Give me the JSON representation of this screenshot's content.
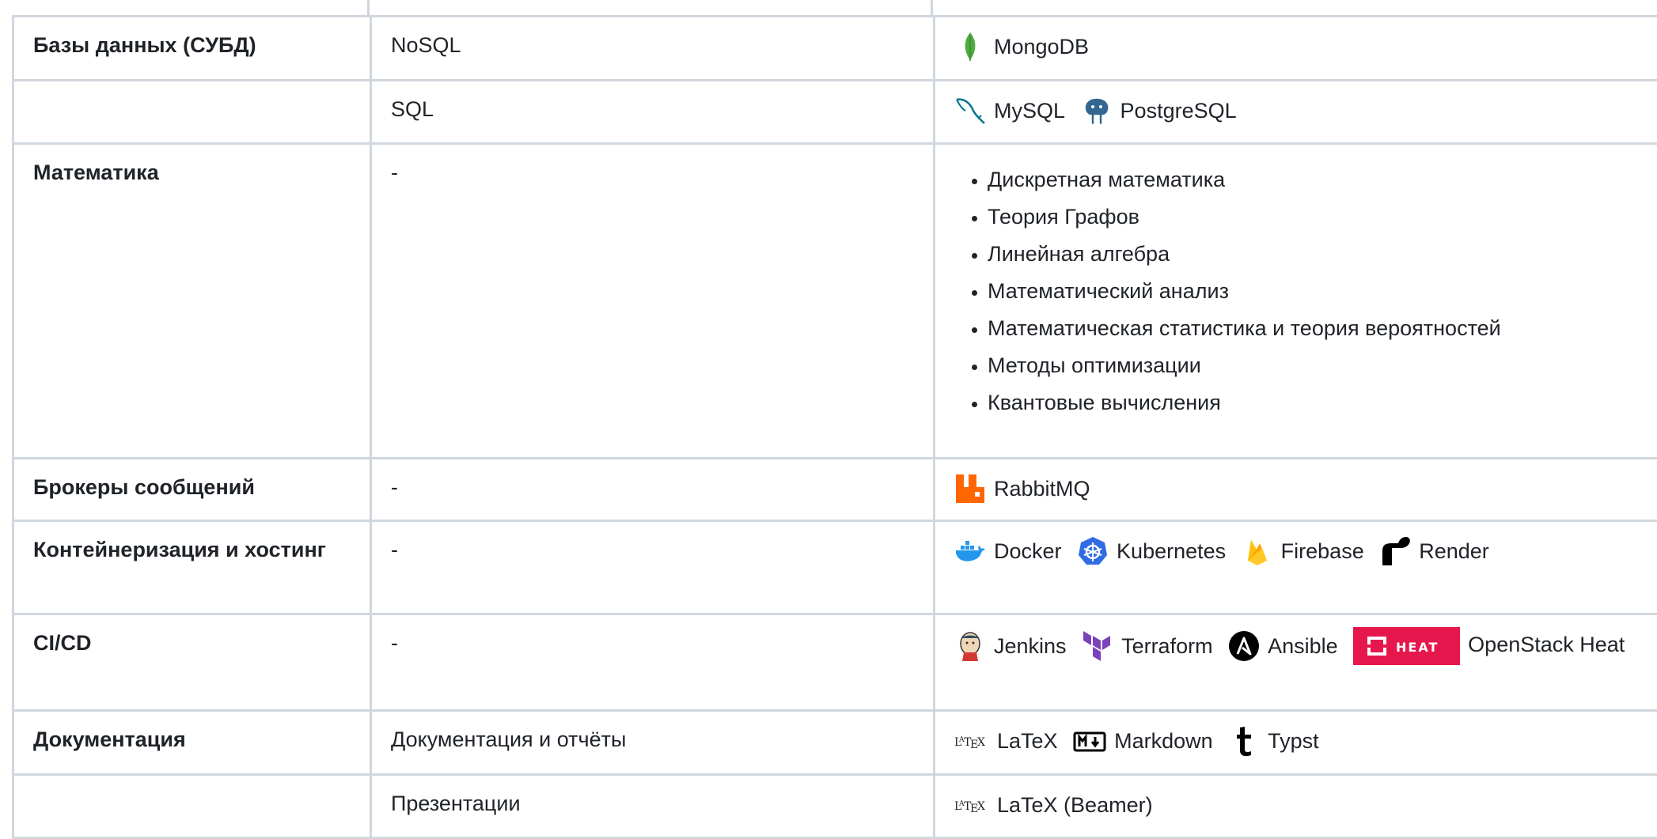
{
  "table": {
    "rows": [
      {
        "category": "Базы данных (СУБД)",
        "sub": "NoSQL",
        "tech": [
          {
            "icon": "mongodb-icon",
            "label": "MongoDB"
          }
        ]
      },
      {
        "category": "",
        "sub": "SQL",
        "tech": [
          {
            "icon": "mysql-icon",
            "label": "MySQL"
          },
          {
            "icon": "postgresql-icon",
            "label": "PostgreSQL"
          }
        ]
      },
      {
        "category": "Математика",
        "sub": "-",
        "list": [
          "Дискретная математика",
          "Теория Графов",
          "Линейная алгебра",
          "Математический анализ",
          "Математическая статистика и теория вероятностей",
          "Методы оптимизации",
          "Квантовые вычисления"
        ]
      },
      {
        "category": "Брокеры сообщений",
        "sub": "-",
        "tech": [
          {
            "icon": "rabbitmq-icon",
            "label": "RabbitMQ"
          }
        ]
      },
      {
        "category": "Контейнеризация и хостинг",
        "sub": "-",
        "tech": [
          {
            "icon": "docker-icon",
            "label": "Docker"
          },
          {
            "icon": "kubernetes-icon",
            "label": "Kubernetes"
          },
          {
            "icon": "firebase-icon",
            "label": "Firebase"
          },
          {
            "icon": "render-icon",
            "label": "Render"
          }
        ]
      },
      {
        "category": "CI/CD",
        "sub": "-",
        "tech": [
          {
            "icon": "jenkins-icon",
            "label": "Jenkins"
          },
          {
            "icon": "terraform-icon",
            "label": "Terraform"
          },
          {
            "icon": "ansible-icon",
            "label": "Ansible"
          },
          {
            "icon": "openstack-heat-badge",
            "badge_text": "HEAT",
            "label": "OpenStack Heat"
          }
        ]
      },
      {
        "category": "Документация",
        "sub": "Документация и отчёты",
        "tech": [
          {
            "icon": "latex-icon",
            "label": "LaTeX"
          },
          {
            "icon": "markdown-icon",
            "label": "Markdown"
          },
          {
            "icon": "typst-icon",
            "label": "Typst"
          }
        ]
      },
      {
        "category": "",
        "sub": "Презентации",
        "tech": [
          {
            "icon": "latex-icon",
            "label": "LaTeX (Beamer)"
          }
        ]
      }
    ]
  },
  "colors": {
    "border": "#d0d7de",
    "text": "#1f2328",
    "mongodb": "#4faa41",
    "rabbitmq": "#ff6600",
    "kubernetes": "#326ce5",
    "firebase": "#ffa000",
    "terraform": "#7b42bc",
    "heat": "#e6174c",
    "docker": "#2496ed",
    "mysql": "#00758f"
  }
}
